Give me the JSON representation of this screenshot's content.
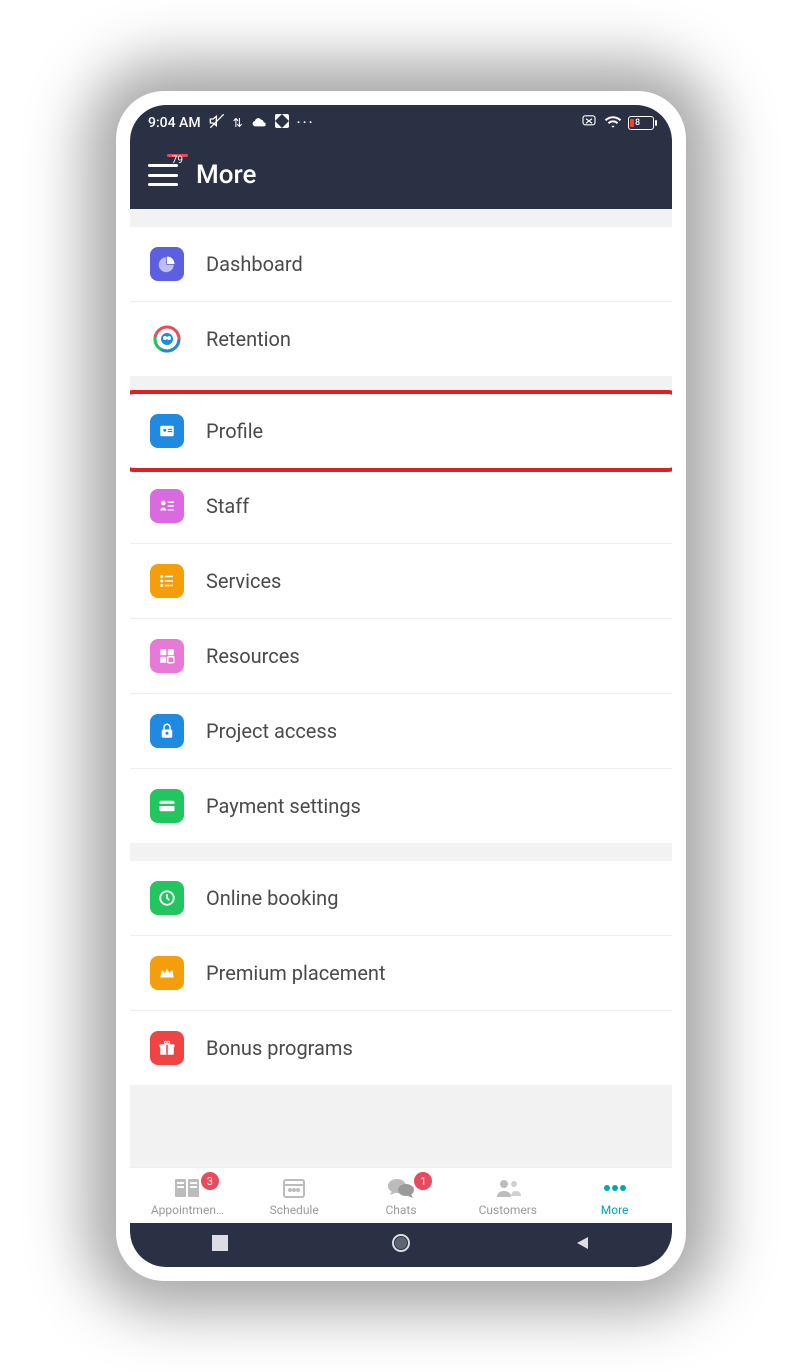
{
  "status": {
    "time": "9:04 AM",
    "battery_percent": "8"
  },
  "header": {
    "title": "More",
    "menu_badge": "79"
  },
  "menu": {
    "group1": [
      {
        "label": "Dashboard",
        "icon": "pie-chart",
        "color": "#5b5fe0"
      },
      {
        "label": "Retention",
        "icon": "retention",
        "color": "#ffffff"
      }
    ],
    "group2": [
      {
        "label": "Profile",
        "icon": "profile-card",
        "color": "#1f8ae0",
        "highlighted": true
      },
      {
        "label": "Staff",
        "icon": "staff-list",
        "color": "#d96adf"
      },
      {
        "label": "Services",
        "icon": "list",
        "color": "#f59e0b"
      },
      {
        "label": "Resources",
        "icon": "grid",
        "color": "#e879d6"
      },
      {
        "label": "Project access",
        "icon": "lock",
        "color": "#1f8ae0"
      },
      {
        "label": "Payment settings",
        "icon": "card",
        "color": "#22c55e"
      }
    ],
    "group3": [
      {
        "label": "Online booking",
        "icon": "clock",
        "color": "#22c55e"
      },
      {
        "label": "Premium placement",
        "icon": "crown",
        "color": "#f59e0b"
      },
      {
        "label": "Bonus programs",
        "icon": "gift",
        "color": "#ef4444"
      }
    ]
  },
  "bottom_nav": [
    {
      "label": "Appointmen…",
      "icon": "appointments",
      "badge": "3",
      "active": false
    },
    {
      "label": "Schedule",
      "icon": "schedule",
      "badge": null,
      "active": false
    },
    {
      "label": "Chats",
      "icon": "chats",
      "badge": "1",
      "active": false
    },
    {
      "label": "Customers",
      "icon": "customers",
      "badge": null,
      "active": false
    },
    {
      "label": "More",
      "icon": "more",
      "badge": null,
      "active": true
    }
  ]
}
